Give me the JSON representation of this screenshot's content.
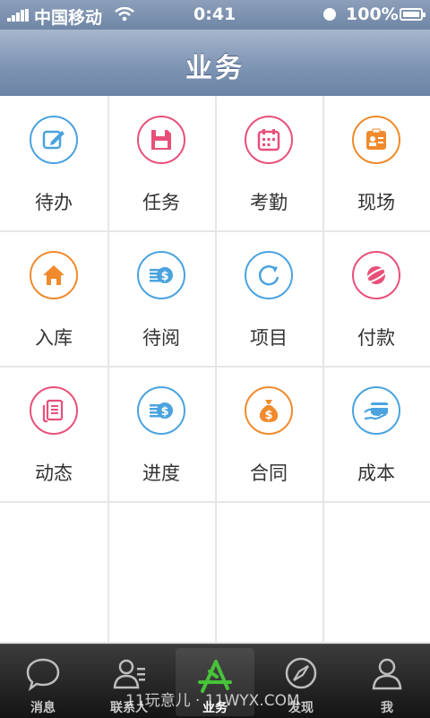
{
  "status_bar": {
    "carrier": "中国移动",
    "time": "0:41",
    "battery": "100%"
  },
  "nav": {
    "title": "业务"
  },
  "grid": {
    "items": [
      {
        "label": "待办",
        "color": "#4aa3df",
        "icon": "edit-icon"
      },
      {
        "label": "任务",
        "color": "#e8507a",
        "icon": "floppy-icon"
      },
      {
        "label": "考勤",
        "color": "#e8507a",
        "icon": "calendar-icon"
      },
      {
        "label": "现场",
        "color": "#f08a2c",
        "icon": "id-card-icon"
      },
      {
        "label": "入库",
        "color": "#f08a2c",
        "icon": "house-icon"
      },
      {
        "label": "待阅",
        "color": "#4aa3df",
        "icon": "coins-icon"
      },
      {
        "label": "项目",
        "color": "#4aa3df",
        "icon": "refresh-icon"
      },
      {
        "label": "付款",
        "color": "#e8507a",
        "icon": "planet-icon"
      },
      {
        "label": "动态",
        "color": "#e8507a",
        "icon": "document-icon"
      },
      {
        "label": "进度",
        "color": "#4aa3df",
        "icon": "coins-icon"
      },
      {
        "label": "合同",
        "color": "#f08a2c",
        "icon": "money-bag-icon"
      },
      {
        "label": "成本",
        "color": "#4aa3df",
        "icon": "credit-card-icon"
      }
    ]
  },
  "tab_bar": {
    "tabs": [
      {
        "label": "消息",
        "icon": "chat-bubble-icon"
      },
      {
        "label": "联系人",
        "icon": "contacts-icon"
      },
      {
        "label": "业务",
        "icon": "app-store-icon",
        "active": true
      },
      {
        "label": "发现",
        "icon": "compass-icon"
      },
      {
        "label": "我",
        "icon": "person-icon"
      }
    ]
  },
  "watermark": "11玩意儿 · 11WYX.COM"
}
